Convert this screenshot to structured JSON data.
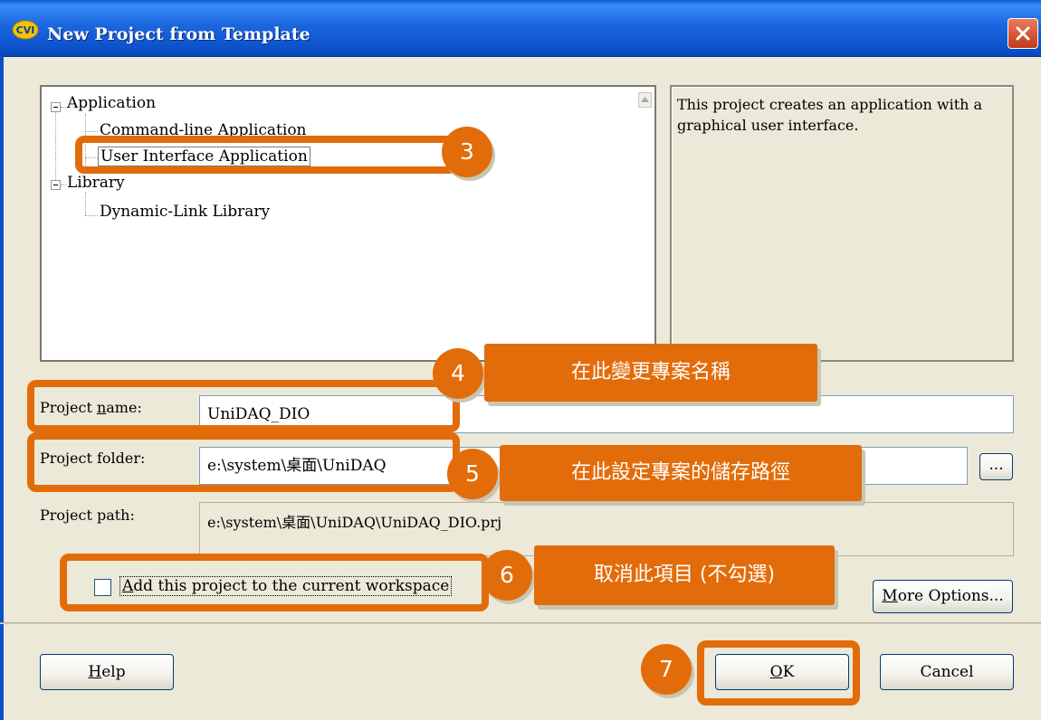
{
  "window": {
    "title": "New Project from Template"
  },
  "tree": {
    "items": [
      {
        "label": "Application"
      },
      {
        "label": "Command-line Application"
      },
      {
        "label": "User Interface Application"
      },
      {
        "label": "Library"
      },
      {
        "label": "Dynamic-Link Library"
      }
    ]
  },
  "description": "This project creates an application with a graphical user interface.",
  "form": {
    "project_name_label_pre": "Project ",
    "project_name_label_acc": "n",
    "project_name_label_post": "ame:",
    "project_name_value": "UniDAQ_DIO",
    "project_folder_label": "Project folder:",
    "project_folder_value": "e:\\system\\桌面\\UniDAQ",
    "project_path_label": "Project path:",
    "project_path_value": "e:\\system\\桌面\\UniDAQ\\UniDAQ_DIO.prj",
    "browse_label": "...",
    "add_to_workspace_acc": "A",
    "add_to_workspace_rest": "dd this project to the current workspace",
    "add_to_workspace_checked": false
  },
  "buttons": {
    "more_options_acc": "M",
    "more_options_rest": "ore Options...",
    "help_acc": "H",
    "help_rest": "elp",
    "ok_acc": "O",
    "ok_rest": "K",
    "cancel": "Cancel"
  },
  "annotations": {
    "step3": "3",
    "step4": "4",
    "step4_text": "在此變更專案名稱",
    "step5": "5",
    "step5_text": "在此設定專案的儲存路徑",
    "step6": "6",
    "step6_text": "取消此項目 (不勾選)",
    "step7": "7"
  },
  "colors": {
    "annotation": "#e36c0a",
    "titlebar": "#0a50c8"
  }
}
